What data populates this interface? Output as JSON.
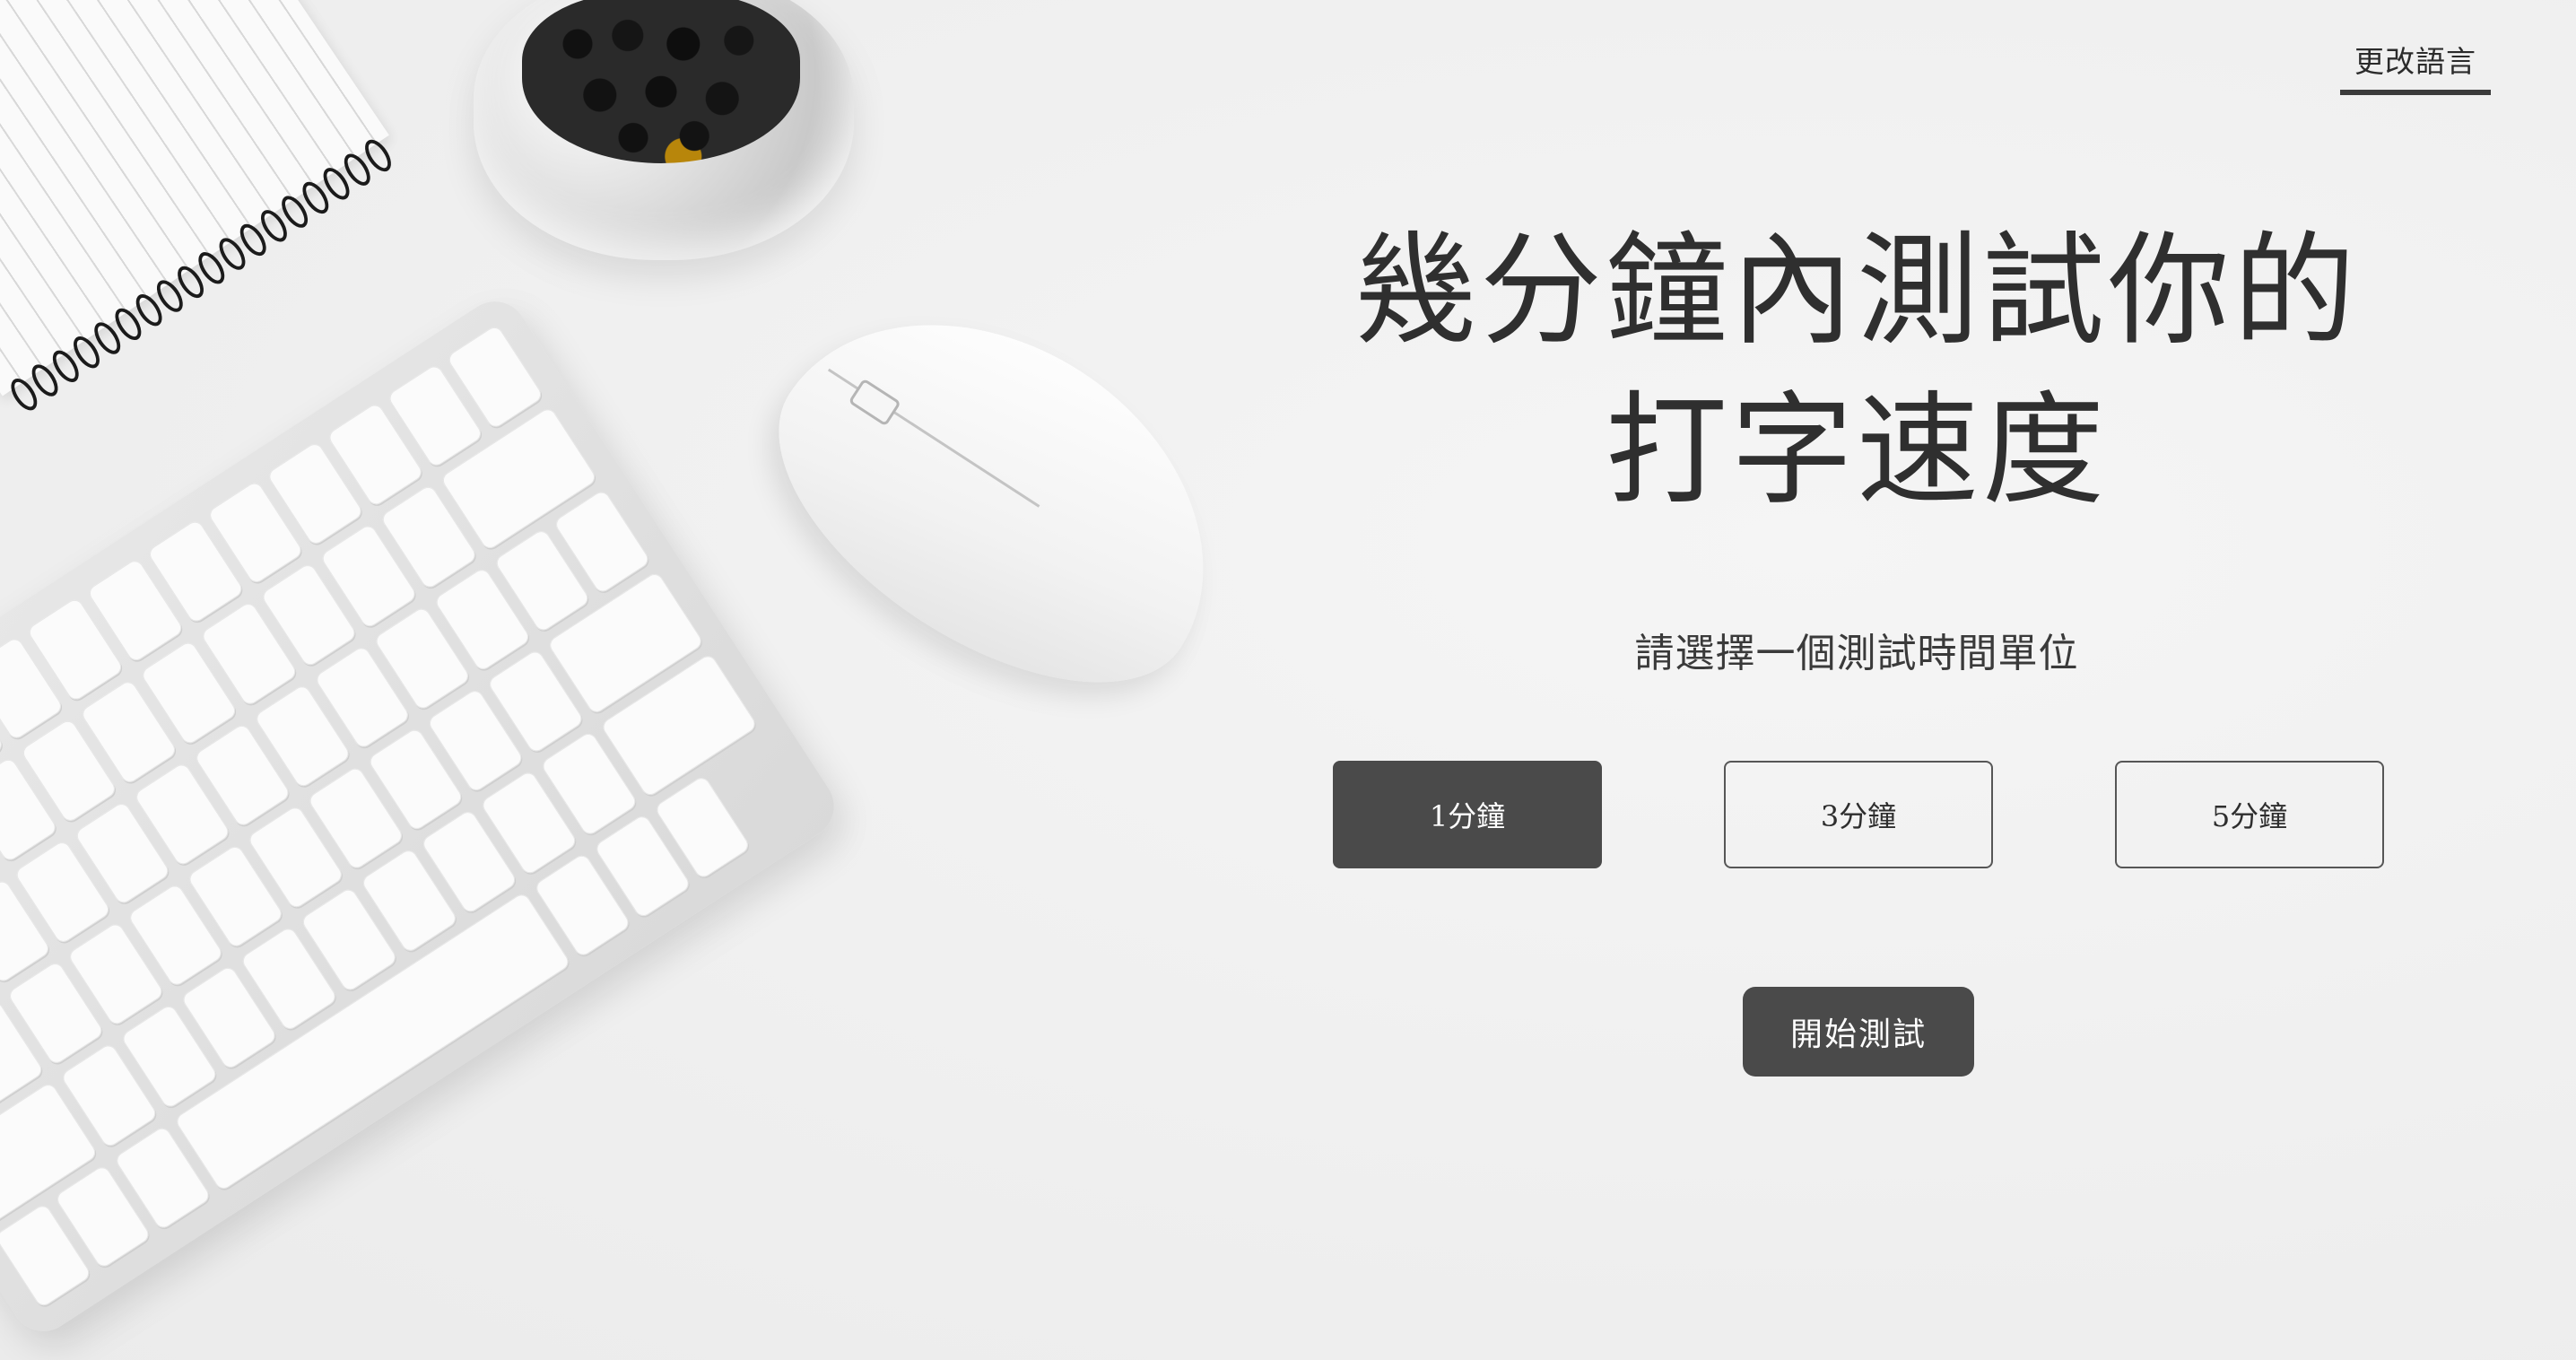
{
  "header": {
    "language_link": "更改語言"
  },
  "hero": {
    "title_line1": "幾分鐘內測試你的",
    "title_line2": "打字速度",
    "subtitle": "請選擇一個測試時間單位"
  },
  "time_options": [
    {
      "label": "1分鐘",
      "selected": true
    },
    {
      "label": "3分鐘",
      "selected": false
    },
    {
      "label": "5分鐘",
      "selected": false
    }
  ],
  "start_button": "開始測試",
  "colors": {
    "background": "#f1f1f1",
    "button_dark": "#4a4a4a",
    "text_dark": "#2f2f2f"
  }
}
